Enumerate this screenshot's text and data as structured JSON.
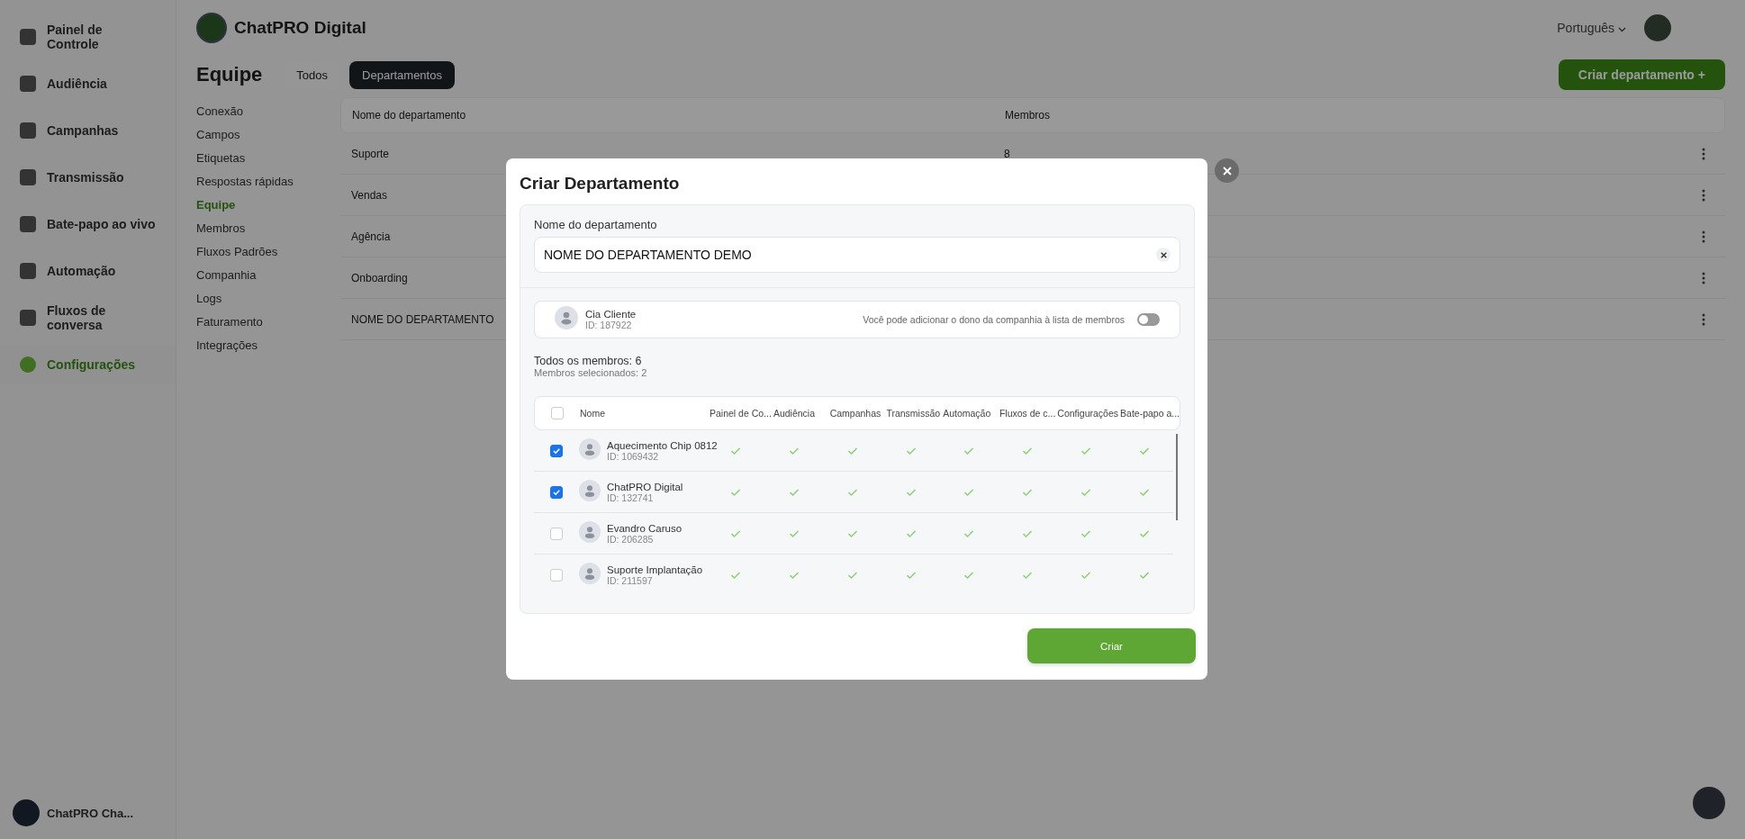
{
  "sidebar": {
    "items": [
      {
        "label": "Painel de Controle",
        "selected": false
      },
      {
        "label": "Audiência",
        "selected": false
      },
      {
        "label": "Campanhas",
        "selected": false
      },
      {
        "label": "Transmissão",
        "selected": false
      },
      {
        "label": "Bate-papo ao vivo",
        "selected": false
      },
      {
        "label": "Automação",
        "selected": false
      },
      {
        "label": "Fluxos de conversa",
        "selected": false
      },
      {
        "label": "Configurações",
        "selected": true
      }
    ],
    "account": {
      "name": "ChatPRO Cha..."
    }
  },
  "header": {
    "brand": "ChatPRO Digital",
    "language": "Português",
    "create_button": "Criar departamento +"
  },
  "page": {
    "title": "Equipe",
    "tabs": [
      {
        "label": "Todos",
        "selected": false
      },
      {
        "label": "Departamentos",
        "selected": true
      }
    ]
  },
  "settings_nav": [
    {
      "label": "Conexão",
      "selected": false
    },
    {
      "label": "Campos",
      "selected": false
    },
    {
      "label": "Etiquetas",
      "selected": false
    },
    {
      "label": "Respostas rápidas",
      "selected": false
    },
    {
      "label": "Equipe",
      "selected": true
    },
    {
      "label": "Membros",
      "selected": false
    },
    {
      "label": "Fluxos Padrões",
      "selected": false
    },
    {
      "label": "Companhia",
      "selected": false
    },
    {
      "label": "Logs",
      "selected": false
    },
    {
      "label": "Faturamento",
      "selected": false
    },
    {
      "label": "Integrações",
      "selected": false
    }
  ],
  "departments_table": {
    "columns": [
      "Nome do departamento",
      "Membros"
    ],
    "rows": [
      {
        "name": "Suporte",
        "members": "8"
      },
      {
        "name": "Vendas",
        "members": ""
      },
      {
        "name": "Agência",
        "members": ""
      },
      {
        "name": "Onboarding",
        "members": ""
      },
      {
        "name": "NOME DO DEPARTAMENTO",
        "members": ""
      }
    ]
  },
  "dialog": {
    "title": "Criar Departamento",
    "name_label": "Nome do departamento",
    "name_value": "NOME DO DEPARTAMENTO DEMO",
    "owner": {
      "name": "Cia Cliente",
      "id": "ID: 187922",
      "hint": "Você pode adicionar o dono da companhia à lista de membros",
      "include": false
    },
    "total_members": "Todos os membros: 6",
    "selected_members": "Membros selecionados: 2",
    "all_selected": false,
    "columns": [
      "Nome",
      "Painel de Co...",
      "Audiência",
      "Campanhas",
      "Transmissão",
      "Automação",
      "Fluxos de c...",
      "Configurações",
      "Bate-papo a..."
    ],
    "members": [
      {
        "name": "Aquecimento Chip 0812",
        "id": "ID: 1069432",
        "selected": true,
        "permissions": [
          true,
          true,
          true,
          true,
          true,
          true,
          true,
          true
        ]
      },
      {
        "name": "ChatPRO Digital",
        "id": "ID: 132741",
        "selected": true,
        "permissions": [
          true,
          true,
          true,
          true,
          true,
          true,
          true,
          true
        ]
      },
      {
        "name": "Evandro Caruso",
        "id": "ID: 206285",
        "selected": false,
        "permissions": [
          true,
          true,
          true,
          true,
          true,
          true,
          true,
          true
        ]
      },
      {
        "name": "Suporte Implantação",
        "id": "ID: 211597",
        "selected": false,
        "permissions": [
          true,
          true,
          true,
          true,
          true,
          true,
          true,
          true
        ]
      }
    ],
    "submit": "Criar"
  }
}
